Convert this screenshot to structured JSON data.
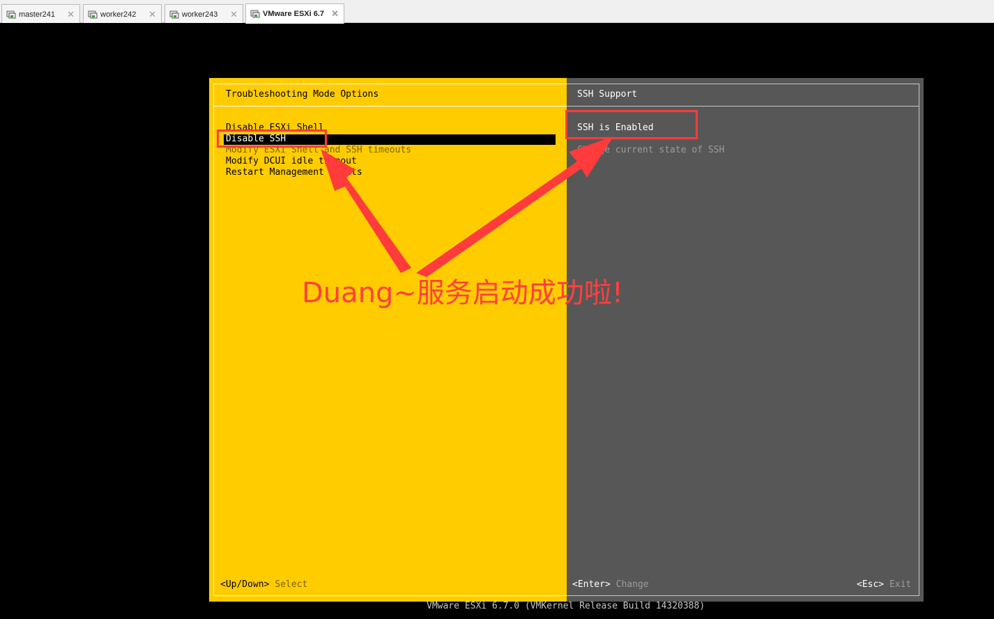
{
  "tabs": [
    {
      "label": "master241",
      "active": false
    },
    {
      "label": "worker242",
      "active": false
    },
    {
      "label": "worker243",
      "active": false
    },
    {
      "label": "VMware ESXi 6.7",
      "active": true
    }
  ],
  "dcui": {
    "left_title": "Troubleshooting Mode Options",
    "menu": [
      "Disable ESXi Shell",
      "Disable SSH",
      "Modify ESXi Shell and SSH timeouts",
      "Modify DCUI idle timeout",
      "Restart Management Agents"
    ],
    "selected_index": 1,
    "right_title": "SSH Support",
    "status": "SSH is Enabled",
    "description": "Change current state of SSH",
    "footer": {
      "select_key": "<Up/Down>",
      "select_label": "Select",
      "change_key": "<Enter>",
      "change_label": "Change",
      "exit_key": "<Esc>",
      "exit_label": "Exit"
    },
    "build": "VMware ESXi 6.7.0 (VMKernel Release Build 14320388)"
  },
  "annotation": {
    "caption": "Duang~服务启动成功啦!",
    "color": "#ff3b3b"
  },
  "colors": {
    "dcui_yellow": "#ffcc00",
    "dcui_gray": "#575757"
  }
}
